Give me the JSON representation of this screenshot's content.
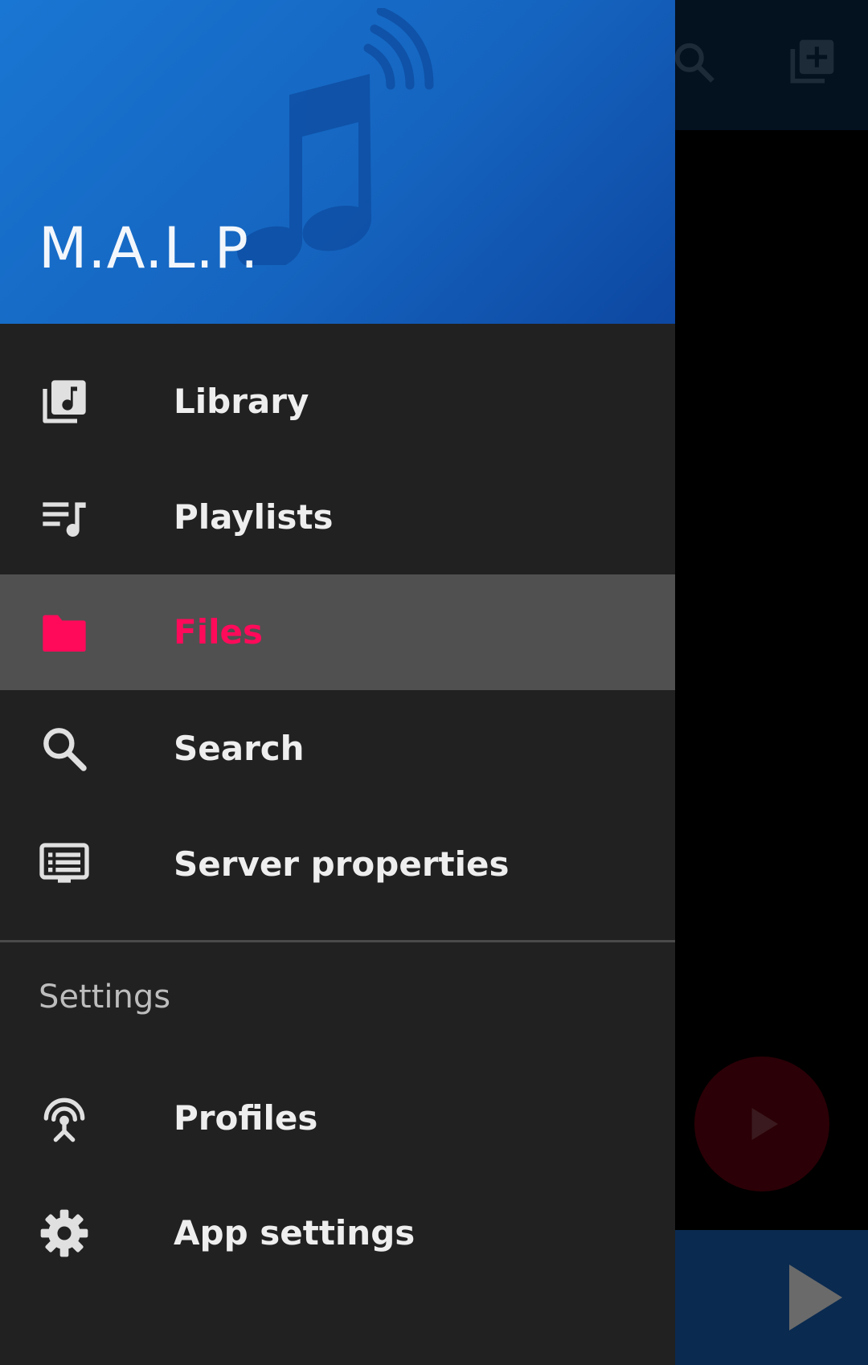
{
  "app": {
    "title": "M.A.L.P."
  },
  "nav": {
    "items": [
      {
        "label": "Library",
        "icon": "library-music-icon"
      },
      {
        "label": "Playlists",
        "icon": "queue-music-icon"
      },
      {
        "label": "Files",
        "icon": "folder-icon",
        "selected": true
      },
      {
        "label": "Search",
        "icon": "search-icon"
      },
      {
        "label": "Server properties",
        "icon": "server-properties-icon"
      }
    ],
    "settings_header": "Settings",
    "settings_items": [
      {
        "label": "Profiles",
        "icon": "profiles-icon"
      },
      {
        "label": "App settings",
        "icon": "gear-icon"
      }
    ]
  },
  "colors": {
    "header_blue": "#1565c0",
    "drawer_bg": "#212121",
    "active_bg": "#505050",
    "accent": "#ff0a5a",
    "icon_grey": "#e0e0e0"
  }
}
